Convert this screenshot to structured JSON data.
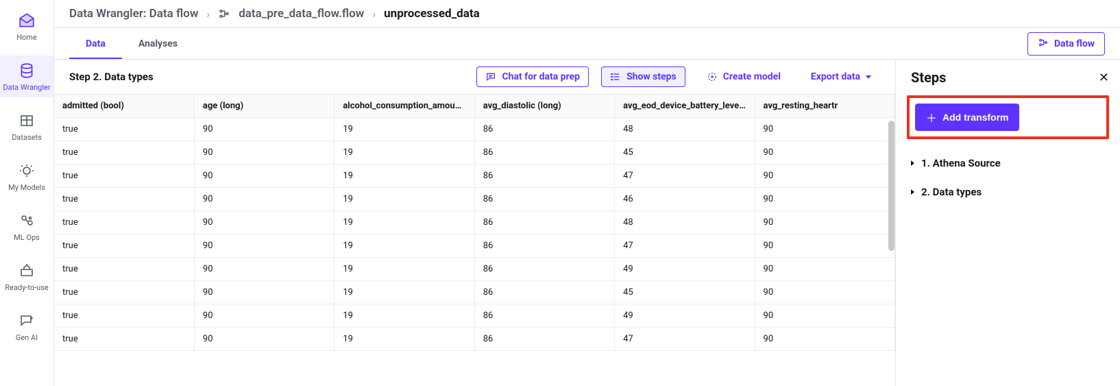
{
  "leftnav": {
    "items": [
      {
        "label": "Home",
        "name": "nav-home"
      },
      {
        "label": "Data Wrangler",
        "name": "nav-data-wrangler",
        "active": true
      },
      {
        "label": "Datasets",
        "name": "nav-datasets"
      },
      {
        "label": "My Models",
        "name": "nav-my-models"
      },
      {
        "label": "ML Ops",
        "name": "nav-ml-ops"
      },
      {
        "label": "Ready-to-use",
        "name": "nav-ready-to-use"
      },
      {
        "label": "Gen AI",
        "name": "nav-gen-ai"
      }
    ]
  },
  "breadcrumb": {
    "root": "Data Wrangler: Data flow",
    "flow": "data_pre_data_flow.flow",
    "node": "unprocessed_data"
  },
  "tabs": {
    "data": "Data",
    "analyses": "Analyses",
    "dataflow_btn": "Data flow"
  },
  "toolbar": {
    "step_title": "Step 2. Data types",
    "chat": "Chat for data prep",
    "show_steps": "Show steps",
    "create_model": "Create model",
    "export_data": "Export data"
  },
  "table": {
    "columns": [
      "admitted (bool)",
      "age (long)",
      "alcohol_consumption_amount (lo",
      "avg_diastolic (long)",
      "avg_eod_device_battery_level (lo",
      "avg_resting_heartr"
    ],
    "rows": [
      [
        "true",
        "90",
        "19",
        "86",
        "48",
        "90"
      ],
      [
        "true",
        "90",
        "19",
        "86",
        "45",
        "90"
      ],
      [
        "true",
        "90",
        "19",
        "86",
        "47",
        "90"
      ],
      [
        "true",
        "90",
        "19",
        "86",
        "46",
        "90"
      ],
      [
        "true",
        "90",
        "19",
        "86",
        "48",
        "90"
      ],
      [
        "true",
        "90",
        "19",
        "86",
        "47",
        "90"
      ],
      [
        "true",
        "90",
        "19",
        "86",
        "49",
        "90"
      ],
      [
        "true",
        "90",
        "19",
        "86",
        "45",
        "90"
      ],
      [
        "true",
        "90",
        "19",
        "86",
        "49",
        "90"
      ],
      [
        "true",
        "90",
        "19",
        "86",
        "47",
        "90"
      ]
    ]
  },
  "steps_panel": {
    "title": "Steps",
    "add_transform": "Add transform",
    "items": [
      "1. Athena Source",
      "2. Data types"
    ]
  }
}
